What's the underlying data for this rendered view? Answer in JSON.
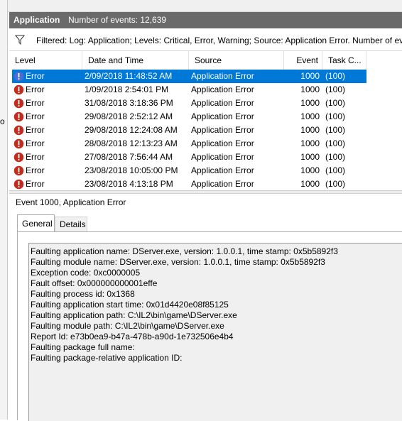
{
  "outside_fragment": "o",
  "header": {
    "title": "Application",
    "event_count": "Number of events: 12,639"
  },
  "filter": {
    "text": "Filtered: Log: Application; Levels: Critical, Error, Warning; Source: Application Error. Number of eve"
  },
  "columns": {
    "level": "Level",
    "datetime": "Date and Time",
    "source": "Source",
    "event_id": "Event ID",
    "task": "Task C..."
  },
  "rows": [
    {
      "level": "Error",
      "datetime": "2/09/2018 11:48:52 AM",
      "source": "Application Error",
      "event_id": "1000",
      "task": "(100)",
      "selected": true
    },
    {
      "level": "Error",
      "datetime": "1/09/2018 2:54:01 PM",
      "source": "Application Error",
      "event_id": "1000",
      "task": "(100)"
    },
    {
      "level": "Error",
      "datetime": "31/08/2018 3:18:36 PM",
      "source": "Application Error",
      "event_id": "1000",
      "task": "(100)"
    },
    {
      "level": "Error",
      "datetime": "29/08/2018 2:52:12 AM",
      "source": "Application Error",
      "event_id": "1000",
      "task": "(100)"
    },
    {
      "level": "Error",
      "datetime": "29/08/2018 12:24:08 AM",
      "source": "Application Error",
      "event_id": "1000",
      "task": "(100)"
    },
    {
      "level": "Error",
      "datetime": "28/08/2018 12:13:23 AM",
      "source": "Application Error",
      "event_id": "1000",
      "task": "(100)"
    },
    {
      "level": "Error",
      "datetime": "27/08/2018 7:56:44 AM",
      "source": "Application Error",
      "event_id": "1000",
      "task": "(100)"
    },
    {
      "level": "Error",
      "datetime": "23/08/2018 10:05:00 PM",
      "source": "Application Error",
      "event_id": "1000",
      "task": "(100)"
    },
    {
      "level": "Error",
      "datetime": "23/08/2018 4:13:18 PM",
      "source": "Application Error",
      "event_id": "1000",
      "task": "(100)"
    }
  ],
  "detail": {
    "title": "Event 1000, Application Error",
    "tabs": [
      "General",
      "Details"
    ],
    "description": [
      "Faulting application name: DServer.exe, version: 1.0.0.1, time stamp: 0x5b5892f3",
      "Faulting module name: DServer.exe, version: 1.0.0.1, time stamp: 0x5b5892f3",
      "Exception code: 0xc0000005",
      "Fault offset: 0x000000000001effe",
      "Faulting process id: 0x1368",
      "Faulting application start time: 0x01d4420e08f85125",
      "Faulting application path: C:\\IL2\\bin\\game\\DServer.exe",
      "Faulting module path: C:\\IL2\\bin\\game\\DServer.exe",
      "Report Id: e73b0ea9-b47a-478b-a90d-1e732506e4b4",
      "Faulting package full name: ",
      "Faulting package-relative application ID: "
    ]
  },
  "colors": {
    "selection": "#0078d7",
    "error_icon": "#c42b1c",
    "header_bg": "#6a6a6a"
  }
}
